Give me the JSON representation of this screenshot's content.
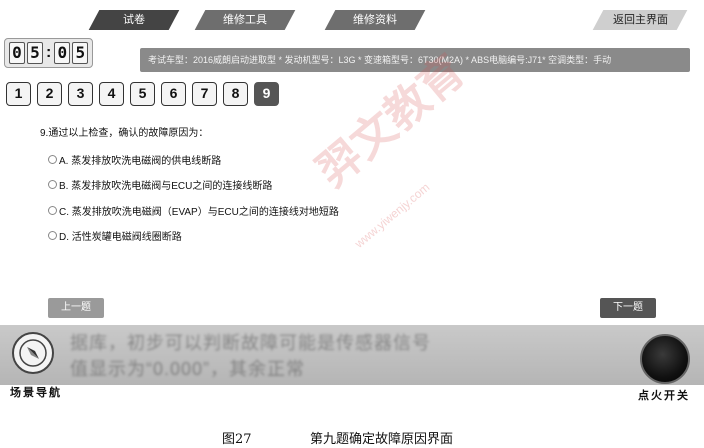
{
  "tabs": [
    {
      "label": "试卷"
    },
    {
      "label": "维修工具"
    },
    {
      "label": "维修资料"
    },
    {
      "label": "返回主界面"
    }
  ],
  "timer": {
    "d1": "0",
    "d2": "5",
    "sep": ":",
    "d3": "0",
    "d4": "5"
  },
  "info_bar": "考试车型：2016威朗启动进取型 * 发动机型号：L3G * 变速箱型号：6T30(M2A) * ABS电脑编号:J71* 空调类型：手动",
  "question_numbers": [
    "1",
    "2",
    "3",
    "4",
    "5",
    "6",
    "7",
    "8",
    "9"
  ],
  "current_question": "9",
  "question": {
    "text": "9.通过以上检查，确认的故障原因为：",
    "options": [
      "A. 蒸发排放吹洗电磁阀的供电线断路",
      "B. 蒸发排放吹洗电磁阀与ECU之间的连接线断路",
      "C. 蒸发排放吹洗电磁阀（EVAP）与ECU之间的连接线对地短路",
      "D. 活性炭罐电磁阀线圈断路"
    ]
  },
  "watermark": {
    "text": "羿文教育",
    "url": "www.yiwenjy.com"
  },
  "nav": {
    "prev": "上一题",
    "next": "下一题"
  },
  "bottom": {
    "scene_nav_label": "场景导航",
    "ignition_label": "点火开关",
    "ghost_line1": "据库，初步可以判断故障可能是传感器信号",
    "ghost_line2": "值显示为“0.000”，其余正常"
  },
  "caption": {
    "figure": "图27",
    "text": "第九题确定故障原因界面"
  },
  "colors": {
    "tab_bg": "#6e6e6e",
    "info_bar_bg": "#8a8a8a",
    "current_q_bg": "#555555"
  },
  "icons": {
    "scene_nav": "compass-icon",
    "ignition": "ignition-button-icon"
  }
}
